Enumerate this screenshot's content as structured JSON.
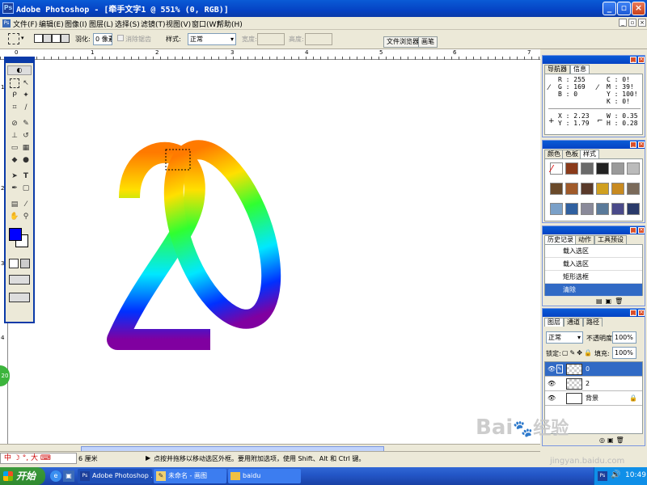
{
  "window": {
    "title": "Adobe Photoshop - [牵手文字1 @ 551% (0, RGB)]",
    "app_icon": "photoshop-icon"
  },
  "menu": [
    "文件(F)",
    "编辑(E)",
    "图像(I)",
    "图层(L)",
    "选择(S)",
    "滤镜(T)",
    "视图(V)",
    "窗口(W)",
    "帮助(H)"
  ],
  "options": {
    "feather_label": "羽化:",
    "feather_value": "0 像素",
    "antialias_label": "消除锯齿",
    "style_label": "样式:",
    "style_value": "正常",
    "width_label": "宽度:",
    "height_label": "高度:",
    "tab1": "文件浏览器",
    "tab2": "画笔"
  },
  "ruler": {
    "h_marks": [
      "0",
      "1",
      "2",
      "3",
      "4",
      "5",
      "6",
      "7"
    ],
    "v_marks": [
      "1",
      "2",
      "3",
      "4"
    ]
  },
  "navinfo": {
    "tab_nav": "导航器",
    "tab_info": "信息",
    "r": "R :  255",
    "g": "G :  169",
    "b": "B :    0",
    "c": "C :    0!",
    "m": "M :   39!",
    "y": "Y :  100!",
    "k": "K :    0!",
    "x": "X :  2.23",
    "yy": "Y :  1.79",
    "w": "W :  0.35",
    "h": "H :  0.28"
  },
  "styles_panel": {
    "tab_color": "颜色",
    "tab_swatch": "色板",
    "tab_style": "样式",
    "swatches": [
      "#ffffff",
      "#8a3a1a",
      "#6a6a6a",
      "#222222",
      "#9a9a9a",
      "#bbbbbb",
      "#6a4a2a",
      "#a05a2a",
      "#5a3a2a",
      "#d0a020",
      "#c88a20",
      "#7a6a5a",
      "#7aa0c8",
      "#3060a0",
      "#8a8a9a",
      "#5a7a9a",
      "#4a4a8a",
      "#2a3a6a"
    ]
  },
  "history": {
    "tab_history": "历史记录",
    "tab_actions": "动作",
    "tab_tools": "工具预设",
    "items": [
      "载入选区",
      "载入选区",
      "矩形选框",
      "清除"
    ]
  },
  "layers": {
    "tab_layers": "图层",
    "tab_channels": "通道",
    "tab_paths": "路径",
    "mode": "正常",
    "opacity_label": "不透明度:",
    "opacity": "100%",
    "lock_label": "锁定:",
    "fill_label": "填充:",
    "fill": "100%",
    "items": [
      "0",
      "2",
      "背景"
    ]
  },
  "status": {
    "zoom": "6 厘米",
    "hint": "点按并拖移以移动选区外框。要用附加选项，使用 Shift、Alt 和 Ctrl 键。",
    "ime": "中",
    "ime_mode": "大"
  },
  "canvas": {
    "text": "20",
    "gradient": [
      "#ff7a00",
      "#ffe000",
      "#30ff30",
      "#00e8ff",
      "#0030ff",
      "#8000a0"
    ],
    "side_badge": "20"
  },
  "taskbar": {
    "start": "开始",
    "items": [
      "Adobe Photoshop ...",
      "未命名 - 画图",
      "baidu"
    ],
    "clock": "10:49"
  },
  "watermark": {
    "brand": "Bai",
    "brand2": "经验",
    "url": "jingyan.baidu.com"
  }
}
